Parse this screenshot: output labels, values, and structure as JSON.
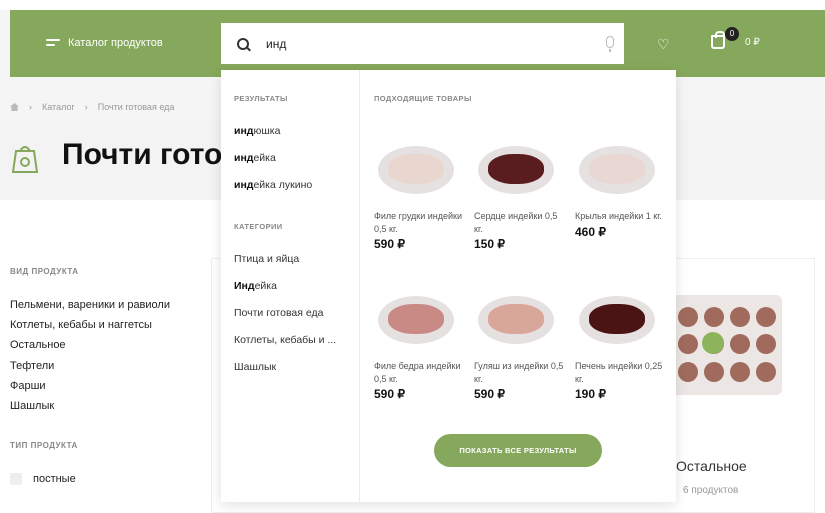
{
  "header": {
    "catalog_label": "Каталог продуктов",
    "search_value": "инд",
    "cart_count": "0",
    "cart_total": "0 ₽"
  },
  "breadcrumb": [
    "Каталог",
    "Почти готовая еда"
  ],
  "page": {
    "title": "Почти готовая еда"
  },
  "filters": {
    "kind_heading": "ВИД ПРОДУКТА",
    "kind_items": [
      "Пельмени, вареники и равиоли",
      "Котлеты, кебабы и наггетсы",
      "Остальное",
      "Тефтели",
      "Фарши",
      "Шашлык"
    ],
    "type_heading": "ТИП ПРОДУКТА",
    "type_items": [
      "постные"
    ]
  },
  "category_card": {
    "title": "Остальное",
    "count": "6 продуктов"
  },
  "dropdown": {
    "results_heading": "РЕЗУЛЬТАТЫ",
    "results": [
      {
        "match": "инд",
        "rest": "юшка"
      },
      {
        "match": "инд",
        "rest": "ейка"
      },
      {
        "match": "инд",
        "rest": "ейка лукино"
      }
    ],
    "categories_heading": "КАТЕГОРИИ",
    "categories": [
      {
        "match": "",
        "rest": "Птица и яйца"
      },
      {
        "match": "Инд",
        "rest": "ейка"
      },
      {
        "match": "",
        "rest": "Почти готовая еда"
      },
      {
        "match": "",
        "rest": "Котлеты, кебабы и ..."
      },
      {
        "match": "",
        "rest": "Шашлык"
      }
    ],
    "products_heading": "ПОДХОДЯЩИЕ ТОВАРЫ",
    "products": [
      {
        "name": "Филе грудки индейки 0,5 кг.",
        "price": "590 ₽",
        "color": "#e9d6cf"
      },
      {
        "name": "Сердце индейки 0,5 кг.",
        "price": "150 ₽",
        "color": "#5a1d1f"
      },
      {
        "name": "Крылья индейки 1 кг.",
        "price": "460 ₽",
        "color": "#e8d7d2"
      },
      {
        "name": "Филе бедра индейки 0,5 кг.",
        "price": "590 ₽",
        "color": "#c98a86"
      },
      {
        "name": "Гуляш из индейки 0,5 кг.",
        "price": "590 ₽",
        "color": "#d9a69a"
      },
      {
        "name": "Печень индейки 0,25 кг.",
        "price": "190 ₽",
        "color": "#4a1414"
      }
    ],
    "show_all_label": "ПОКАЗАТЬ ВСЕ РЕЗУЛЬТАТЫ"
  },
  "colors": {
    "brand_green": "#86a85c"
  }
}
